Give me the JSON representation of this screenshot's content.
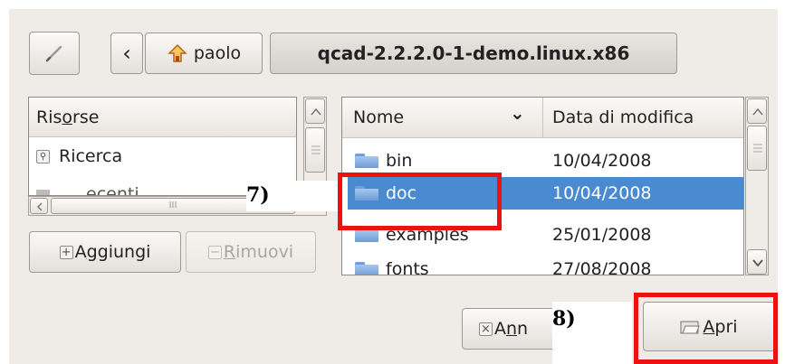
{
  "toolbar": {
    "edit_path_icon": "pencil-icon",
    "back_glyph": "‹",
    "home_icon": "home-up-arrow-icon",
    "home_label": "paolo",
    "current_folder": "qcad-2.2.2.0-1-demo.linux.x86"
  },
  "places": {
    "header_pre": "Ris",
    "header_accel": "o",
    "header_post": "rse",
    "items": [
      {
        "label": "Ricerca",
        "icon": "search-icon"
      },
      {
        "label": "ecenti",
        "icon": "recent-icon"
      }
    ],
    "hscroll_grip": "III",
    "add_button": {
      "icon": "+",
      "accel": "g",
      "pre": "A",
      "post": "giungi"
    },
    "remove_button": {
      "icon": "−",
      "accel": "R",
      "post": "imuovi"
    }
  },
  "files": {
    "columns": {
      "name": "Nome",
      "sort_glyph": "⌄",
      "date": "Data di modifica"
    },
    "rows": [
      {
        "name": "bin",
        "date": "10/04/2008",
        "selected": false
      },
      {
        "name": "doc",
        "date": "10/04/2008",
        "selected": true
      },
      {
        "name": "examples",
        "date": "25/01/2008",
        "selected": false
      },
      {
        "name": "fonts",
        "date": "27/08/2008",
        "selected": false
      }
    ]
  },
  "actions": {
    "cancel": {
      "icon": "×",
      "pre": "A",
      "accel": "n",
      "post": "n"
    },
    "open": {
      "icon": "open-folder-icon",
      "accel": "A",
      "post": "pri"
    }
  },
  "annotations": {
    "step7": "7)",
    "step8": "8)"
  },
  "colors": {
    "selection": "#4a8ad0",
    "annotation": "#ee1111",
    "dialog_bg": "#efebe7"
  }
}
